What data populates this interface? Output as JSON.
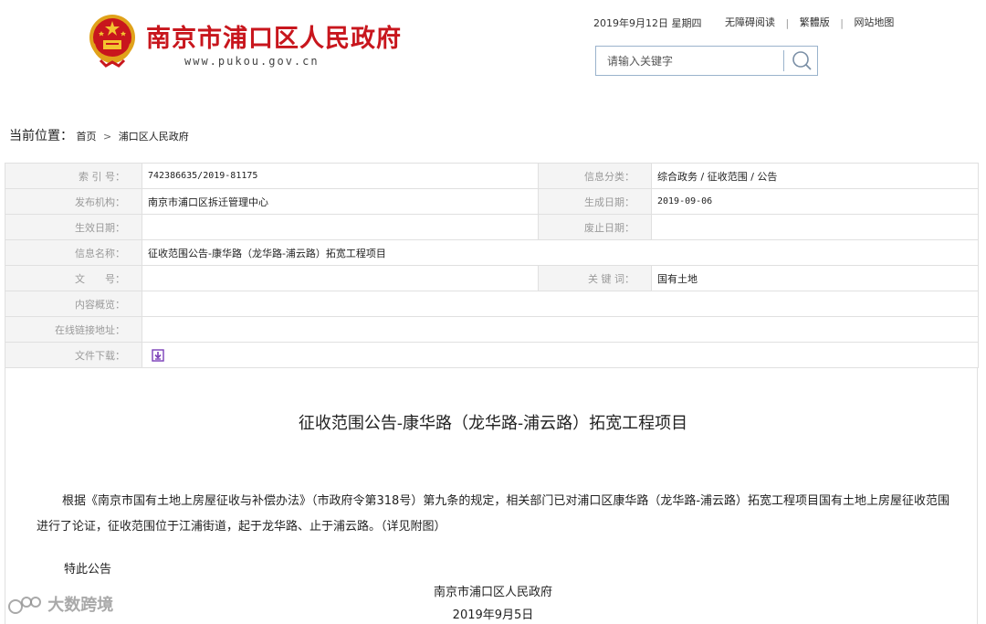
{
  "header": {
    "site_title": "南京市浦口区人民政府",
    "site_url": "www.pukou.gov.cn"
  },
  "topbar": {
    "date": "2019年9月12日  星期四",
    "links": [
      "无障碍阅读",
      "繁體版",
      "网站地图"
    ]
  },
  "search": {
    "placeholder": "请输入关键字"
  },
  "breadcrumb": {
    "label": "当前位置：",
    "items": [
      "首页",
      "浦口区人民政府"
    ]
  },
  "info": {
    "index_label": "索 引 号：",
    "index_value": "742386635/2019-81175",
    "category_label": "信息分类：",
    "category_value": "综合政务 / 征收范围 / 公告",
    "publisher_label": "发布机构：",
    "publisher_value": "南京市浦口区拆迁管理中心",
    "created_label": "生成日期：",
    "created_value": "2019-09-06",
    "effective_label": "生效日期：",
    "effective_value": "",
    "expiry_label": "废止日期：",
    "expiry_value": "",
    "name_label": "信息名称：",
    "name_value": "征收范围公告-康华路（龙华路-浦云路）拓宽工程项目",
    "doc_no_label": "文　　号：",
    "doc_no_value": "",
    "keywords_label": "关 键 词：",
    "keywords_value": "国有土地",
    "summary_label": "内容概览：",
    "summary_value": "",
    "link_label": "在线链接地址：",
    "link_value": "",
    "download_label": "文件下载："
  },
  "article": {
    "title": "征收范围公告-康华路（龙华路-浦云路）拓宽工程项目",
    "body": "根据《南京市国有土地上房屋征收与补偿办法》（市政府令第318号）第九条的规定，相关部门已对浦口区康华路（龙华路-浦云路）拓宽工程项目国有土地上房屋征收范围进行了论证，征收范围位于江浦街道，起于龙华路、止于浦云路。（详见附图）",
    "closing": "特此公告",
    "signature_org": "南京市浦口区人民政府",
    "signature_date": "2019年9月5日"
  },
  "watermark": "大数跨境",
  "colors": {
    "brand_red": "#c8161d",
    "download_icon": "#7b3fb8"
  }
}
